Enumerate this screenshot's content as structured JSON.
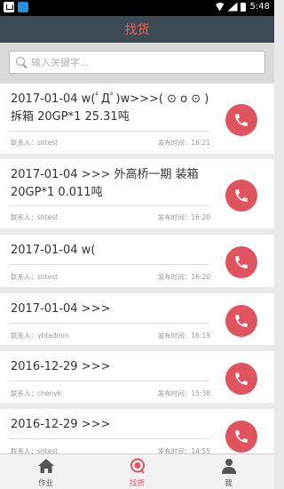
{
  "status_bar": {
    "time": "5:48"
  },
  "header": {
    "title": "找货"
  },
  "search": {
    "placeholder": "输入关键字..."
  },
  "contact_label": "联系人：",
  "publish_label": "发布时间：",
  "listings": [
    {
      "title": "2017-01-04 w(ﾟДﾟ)w>>>( ⊙ o ⊙ ) 拆箱 20GP*1 25.31吨",
      "contact": "shtest",
      "time": "16:21"
    },
    {
      "title": "2017-01-04 >>> 外高桥一期 装箱 20GP*1 0.011吨",
      "contact": "shtest",
      "time": "16:20"
    },
    {
      "title": "2017-01-04 w(",
      "contact": "shtest",
      "time": "16:20"
    },
    {
      "title": "2017-01-04 >>>",
      "contact": "yhtadmin",
      "time": "16:19"
    },
    {
      "title": "2016-12-29 >>>",
      "contact": "chenyk",
      "time": "15:38"
    },
    {
      "title": "2016-12-29 >>>",
      "contact": "shtest",
      "time": "14:55"
    }
  ],
  "nav": {
    "items": [
      {
        "label": "作业",
        "icon": "home-icon"
      },
      {
        "label": "找货",
        "icon": "chat-icon"
      },
      {
        "label": "我",
        "icon": "user-icon"
      }
    ],
    "active": "找货"
  },
  "colors": {
    "accent": "#e0545f",
    "header_bg": "#3d4a53",
    "header_title": "#e26464"
  }
}
